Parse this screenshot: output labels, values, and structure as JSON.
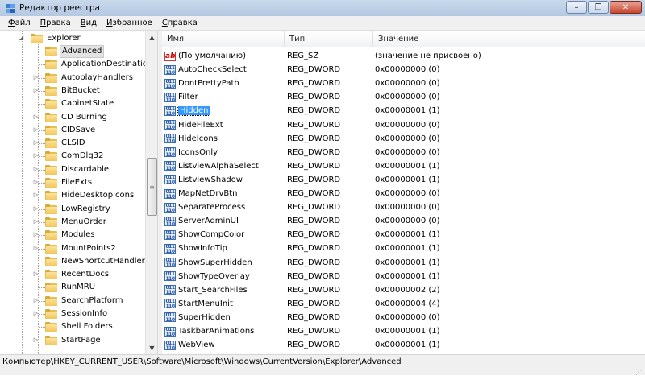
{
  "window": {
    "title": "Редактор реестра",
    "minimize_glyph": "–",
    "maximize_glyph": "❐",
    "close_glyph": "✕"
  },
  "menu": [
    {
      "first": "Ф",
      "rest": "айл"
    },
    {
      "first": "П",
      "rest": "равка"
    },
    {
      "first": "В",
      "rest": "ид"
    },
    {
      "first": "И",
      "rest": "збранное"
    },
    {
      "first": "С",
      "rest": "правка"
    }
  ],
  "tree": {
    "parent": {
      "label": "Explorer",
      "expander": "◢"
    },
    "children": [
      {
        "label": "Advanced",
        "selected": true,
        "expandable": false
      },
      {
        "label": "ApplicationDestinations",
        "expandable": false
      },
      {
        "label": "AutoplayHandlers",
        "expandable": true
      },
      {
        "label": "BitBucket",
        "expandable": true
      },
      {
        "label": "CabinetState",
        "expandable": false
      },
      {
        "label": "CD Burning",
        "expandable": true
      },
      {
        "label": "CIDSave",
        "expandable": true
      },
      {
        "label": "CLSID",
        "expandable": true
      },
      {
        "label": "ComDlg32",
        "expandable": true
      },
      {
        "label": "Discardable",
        "expandable": true
      },
      {
        "label": "FileExts",
        "expandable": true
      },
      {
        "label": "HideDesktopIcons",
        "expandable": true
      },
      {
        "label": "LowRegistry",
        "expandable": true
      },
      {
        "label": "MenuOrder",
        "expandable": true
      },
      {
        "label": "Modules",
        "expandable": true
      },
      {
        "label": "MountPoints2",
        "expandable": true
      },
      {
        "label": "NewShortcutHandlers",
        "expandable": false
      },
      {
        "label": "RecentDocs",
        "expandable": true
      },
      {
        "label": "RunMRU",
        "expandable": false
      },
      {
        "label": "SearchPlatform",
        "expandable": true
      },
      {
        "label": "SessionInfo",
        "expandable": true
      },
      {
        "label": "Shell Folders",
        "expandable": false
      },
      {
        "label": "StartPage",
        "expandable": true
      }
    ]
  },
  "list": {
    "columns": {
      "name": "Имя",
      "type": "Тип",
      "value": "Значение"
    },
    "rows": [
      {
        "icon": "string",
        "name": "(По умолчанию)",
        "type": "REG_SZ",
        "value": "(значение не присвоено)"
      },
      {
        "icon": "binary",
        "name": "AutoCheckSelect",
        "type": "REG_DWORD",
        "value": "0x00000000 (0)"
      },
      {
        "icon": "binary",
        "name": "DontPrettyPath",
        "type": "REG_DWORD",
        "value": "0x00000000 (0)"
      },
      {
        "icon": "binary",
        "name": "Filter",
        "type": "REG_DWORD",
        "value": "0x00000000 (0)"
      },
      {
        "icon": "binary",
        "name": "Hidden",
        "type": "REG_DWORD",
        "value": "0x00000001 (1)",
        "selected": true
      },
      {
        "icon": "binary",
        "name": "HideFileExt",
        "type": "REG_DWORD",
        "value": "0x00000000 (0)"
      },
      {
        "icon": "binary",
        "name": "HideIcons",
        "type": "REG_DWORD",
        "value": "0x00000000 (0)"
      },
      {
        "icon": "binary",
        "name": "IconsOnly",
        "type": "REG_DWORD",
        "value": "0x00000000 (0)"
      },
      {
        "icon": "binary",
        "name": "ListviewAlphaSelect",
        "type": "REG_DWORD",
        "value": "0x00000001 (1)"
      },
      {
        "icon": "binary",
        "name": "ListviewShadow",
        "type": "REG_DWORD",
        "value": "0x00000001 (1)"
      },
      {
        "icon": "binary",
        "name": "MapNetDrvBtn",
        "type": "REG_DWORD",
        "value": "0x00000000 (0)"
      },
      {
        "icon": "binary",
        "name": "SeparateProcess",
        "type": "REG_DWORD",
        "value": "0x00000000 (0)"
      },
      {
        "icon": "binary",
        "name": "ServerAdminUI",
        "type": "REG_DWORD",
        "value": "0x00000000 (0)"
      },
      {
        "icon": "binary",
        "name": "ShowCompColor",
        "type": "REG_DWORD",
        "value": "0x00000001 (1)"
      },
      {
        "icon": "binary",
        "name": "ShowInfoTip",
        "type": "REG_DWORD",
        "value": "0x00000001 (1)"
      },
      {
        "icon": "binary",
        "name": "ShowSuperHidden",
        "type": "REG_DWORD",
        "value": "0x00000001 (1)"
      },
      {
        "icon": "binary",
        "name": "ShowTypeOverlay",
        "type": "REG_DWORD",
        "value": "0x00000001 (1)"
      },
      {
        "icon": "binary",
        "name": "Start_SearchFiles",
        "type": "REG_DWORD",
        "value": "0x00000002 (2)"
      },
      {
        "icon": "binary",
        "name": "StartMenuInit",
        "type": "REG_DWORD",
        "value": "0x00000004 (4)"
      },
      {
        "icon": "binary",
        "name": "SuperHidden",
        "type": "REG_DWORD",
        "value": "0x00000000 (0)"
      },
      {
        "icon": "binary",
        "name": "TaskbarAnimations",
        "type": "REG_DWORD",
        "value": "0x00000001 (1)"
      },
      {
        "icon": "binary",
        "name": "WebView",
        "type": "REG_DWORD",
        "value": "0x00000001 (1)"
      }
    ]
  },
  "status": {
    "path": "Компьютер\\HKEY_CURRENT_USER\\Software\\Microsoft\\Windows\\CurrentVersion\\Explorer\\Advanced"
  }
}
